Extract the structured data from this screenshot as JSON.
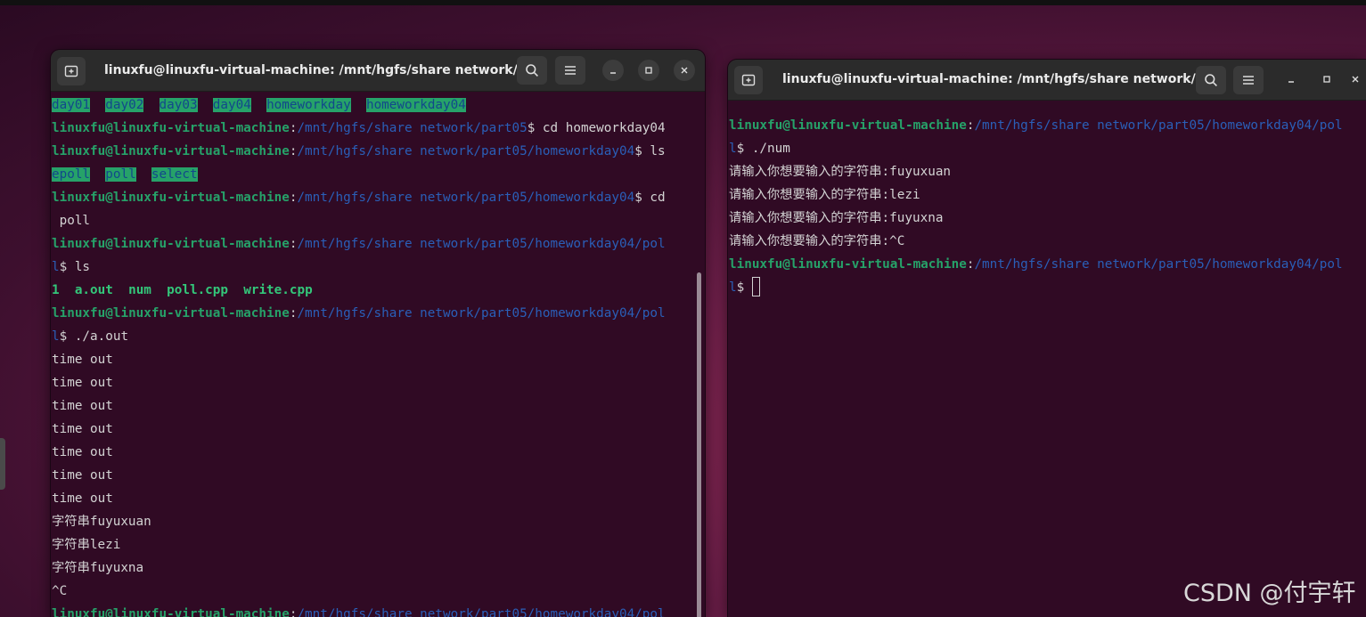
{
  "window_left": {
    "title": "linuxfu@linuxfu-virtual-machine: /mnt/hgfs/share network/...",
    "user": "linuxfu@linuxfu-virtual-machine",
    "lines": {
      "dirs": [
        "day01",
        "day02",
        "day03",
        "day04",
        "homeworkday",
        "homeworkday04"
      ],
      "p1": "/mnt/hgfs/share network/part05",
      "c1": "$ cd homeworkday04",
      "p2": "/mnt/hgfs/share network/part05/homeworkday04",
      "c2": "$ ls",
      "dirs2": [
        "epoll",
        "poll",
        "select"
      ],
      "p3": "/mnt/hgfs/share network/part05/homeworkday04",
      "c3": "$ cd",
      "c3b": " poll",
      "p4": "/mnt/hgfs/share network/part05/homeworkday04/pol",
      "p4b": "l",
      "c4": "$ ls",
      "files": [
        "1",
        "a.out",
        "num",
        "poll.cpp",
        "write.cpp"
      ],
      "p5": "/mnt/hgfs/share network/part05/homeworkday04/pol",
      "p5b": "l",
      "c5": "$ ./a.out",
      "out": [
        "time out",
        "time out",
        "time out",
        "time out",
        "time out",
        "time out",
        "time out",
        "字符串fuyuxuan",
        "字符串lezi",
        "字符串fuyuxna",
        "^C"
      ],
      "p6": "/mnt/hgfs/share network/part05/homeworkday04/pol"
    }
  },
  "window_right": {
    "title": "linuxfu@linuxfu-virtual-machine: /mnt/hgfs/share network/...",
    "user": "linuxfu@linuxfu-virtual-machine",
    "lines": {
      "p1": "/mnt/hgfs/share network/part05/homeworkday04/pol",
      "p1b": "l",
      "c1": "$ ./num",
      "out": [
        "请输入你想要输入的字符串:fuyuxuan",
        "请输入你想要输入的字符串:lezi",
        "请输入你想要输入的字符串:fuyuxna",
        "请输入你想要输入的字符串:^C"
      ],
      "p2": "/mnt/hgfs/share network/part05/homeworkday04/pol",
      "p2b": "l",
      "c2": "$ "
    }
  },
  "watermark": "CSDN @付宇轩",
  "icons": {
    "new_tab": "new-tab-icon",
    "search": "search-icon",
    "menu": "hamburger-menu-icon",
    "minimize": "minimize-icon",
    "maximize": "maximize-icon",
    "close": "close-icon"
  },
  "colors": {
    "terminal_bg": "#300a24",
    "user_green": "#26a269",
    "path_blue": "#2a5fb8",
    "text": "#d3d3d3"
  }
}
